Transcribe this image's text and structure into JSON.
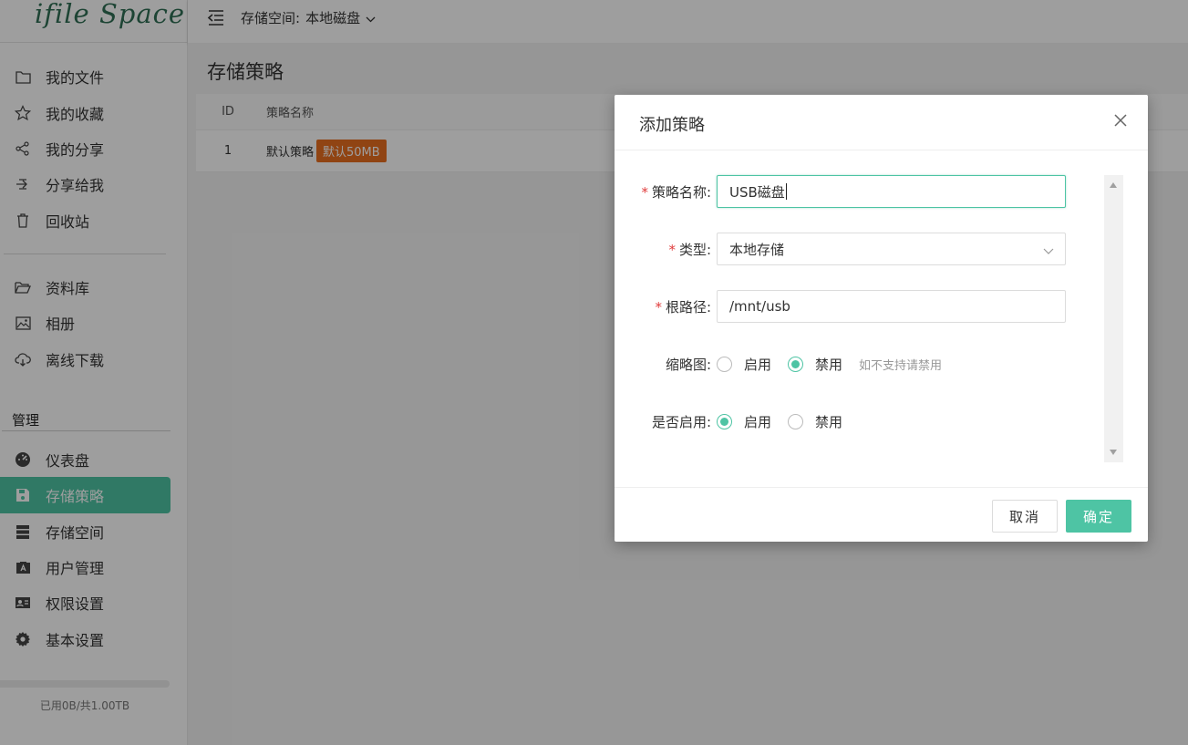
{
  "app": {
    "logo": "ifile Space"
  },
  "sidebar": {
    "items": [
      {
        "label": "我的文件",
        "icon": "folder-icon"
      },
      {
        "label": "我的收藏",
        "icon": "star-icon"
      },
      {
        "label": "我的分享",
        "icon": "share-icon"
      },
      {
        "label": "分享给我",
        "icon": "shared-to-me-icon"
      },
      {
        "label": "回收站",
        "icon": "trash-icon"
      },
      {
        "label": "资料库",
        "icon": "folder-open-icon"
      },
      {
        "label": "相册",
        "icon": "image-icon"
      },
      {
        "label": "离线下载",
        "icon": "cloud-download-icon"
      }
    ],
    "group_title": "管理",
    "admin_items": [
      {
        "label": "仪表盘",
        "icon": "dashboard-icon"
      },
      {
        "label": "存储策略",
        "icon": "storage-policy-icon",
        "active": true
      },
      {
        "label": "存储空间",
        "icon": "server-icon"
      },
      {
        "label": "用户管理",
        "icon": "user-card-icon"
      },
      {
        "label": "权限设置",
        "icon": "id-card-icon"
      },
      {
        "label": "基本设置",
        "icon": "gear-icon"
      }
    ],
    "usage": "已用0B/共1.00TB",
    "usage_fraction": 0
  },
  "header": {
    "storage_label": "存储空间:",
    "storage_value": "本地磁盘"
  },
  "main": {
    "title": "存储策略",
    "table": {
      "columns": [
        "ID",
        "策略名称"
      ],
      "rows": [
        {
          "id": "1",
          "name": "默认策略",
          "tag": "默认50MB"
        }
      ]
    }
  },
  "dialog": {
    "title": "添加策略",
    "fields": {
      "name": {
        "label": "策略名称:",
        "value": "USB磁盘",
        "required": true
      },
      "type": {
        "label": "类型:",
        "value": "本地存储",
        "required": true
      },
      "root": {
        "label": "根路径:",
        "value": "/mnt/usb",
        "required": true
      }
    },
    "thumbnail": {
      "label": "缩略图:",
      "options": [
        "启用",
        "禁用"
      ],
      "selected": "禁用",
      "hint": "如不支持请禁用"
    },
    "enabled": {
      "label": "是否启用:",
      "options": [
        "启用",
        "禁用"
      ],
      "selected": "启用"
    },
    "cancel_label": "取消",
    "ok_label": "确定"
  },
  "colors": {
    "accent": "#4ec4a4",
    "tag": "#e96f20",
    "required": "#e03c3c"
  }
}
